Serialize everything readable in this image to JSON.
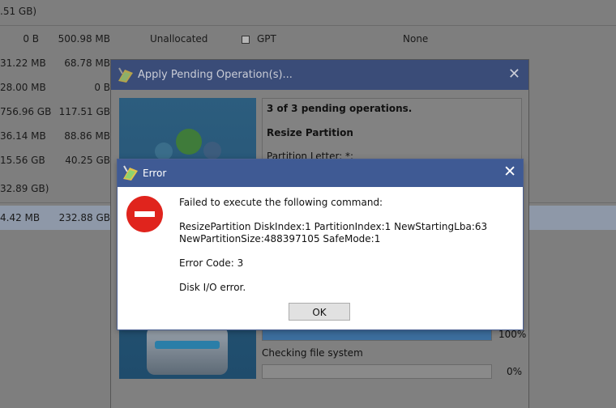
{
  "background": {
    "header_size": ".51 GB)",
    "rows": [
      {
        "col1": "0 B",
        "col2": "500.98 MB",
        "col3": "Unallocated",
        "col5": "GPT",
        "col6": "None",
        "checkbox": true
      },
      {
        "col1": "31.22 MB",
        "col2": "68.78 MB",
        "col3": "",
        "col5": "",
        "col6": "",
        "checkbox": false
      },
      {
        "col1": "28.00 MB",
        "col2": "0 B",
        "col3": "",
        "col5": "",
        "col6": "",
        "checkbox": false
      },
      {
        "col1": "756.96 GB",
        "col2": "117.51 GB",
        "col3": "",
        "col5": "",
        "col6": "",
        "checkbox": false
      },
      {
        "col1": "36.14 MB",
        "col2": "88.86 MB",
        "col3": "",
        "col5": "",
        "col6": "",
        "checkbox": false
      },
      {
        "col1": "15.56 GB",
        "col2": "40.25 GB",
        "col3": "",
        "col5": "",
        "col6": "",
        "checkbox": false
      }
    ],
    "disk2_size": "32.89 GB)",
    "selected_row": {
      "col1": "4.42 MB",
      "col2": "232.88 GB"
    }
  },
  "apply_window": {
    "title": "Apply Pending Operation(s)...",
    "close_glyph": "✕",
    "pending_count": "3 of 3 pending operations.",
    "operation": "Resize Partition",
    "partition_letter": "Partition Letter: *:",
    "progress1_pct": "100%",
    "progress1_value": 1.0,
    "step2_label": "Checking file system",
    "progress2_pct": "0%",
    "progress2_value": 0.0
  },
  "error_dialog": {
    "title": "Error",
    "close_glyph": "✕",
    "icon": "error-stop-icon",
    "line1": "Failed to execute the following command:",
    "line2": "ResizePartition DiskIndex:1 PartitionIndex:1 NewStartingLba:63",
    "line3": "NewPartitionSize:488397105 SafeMode:1",
    "line4": "Error Code: 3",
    "line5": "Disk I/O error.",
    "ok_label": "OK"
  },
  "colors": {
    "title_bar": "#3f5a94",
    "error_red": "#e0241d",
    "progress_fill": "#3c6e9e"
  }
}
